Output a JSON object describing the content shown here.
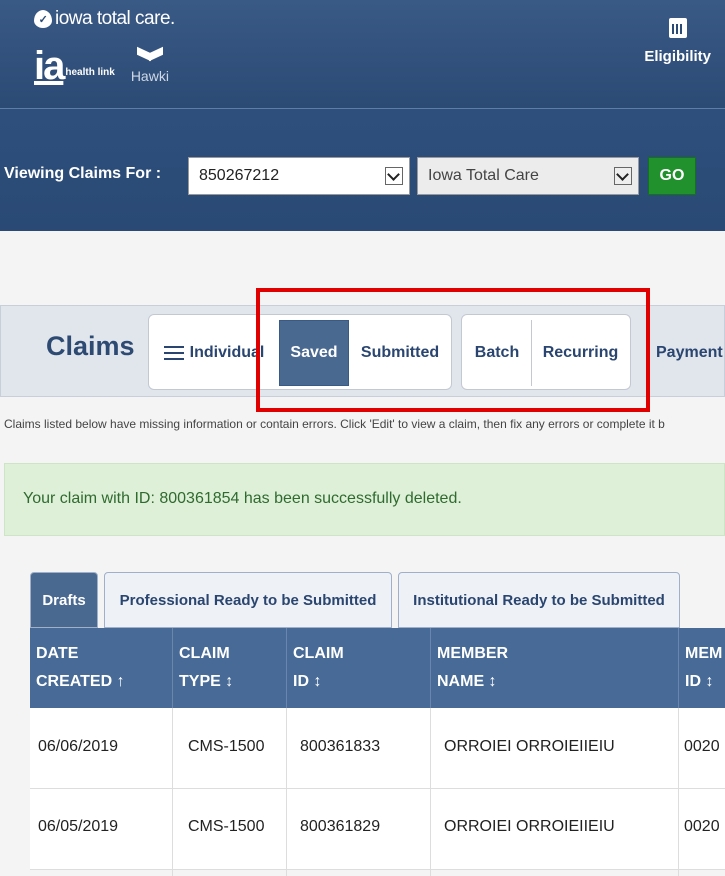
{
  "header": {
    "brand": "iowa total care.",
    "ia_logo": "ia",
    "health_link": "health link",
    "hawki": "Hawki",
    "eligibility": "Eligibility"
  },
  "filter": {
    "label": "Viewing Claims For :",
    "provider_id": "850267212",
    "plan": "Iowa Total Care",
    "go": "GO"
  },
  "claims_nav": {
    "title": "Claims",
    "individual": "Individual",
    "saved": "Saved",
    "submitted": "Submitted",
    "batch": "Batch",
    "recurring": "Recurring",
    "payment": "Payment"
  },
  "info_text": "Claims listed below have missing information or contain errors. Click 'Edit' to view a claim, then fix any errors or complete it b",
  "alert_text": "Your claim with ID: 800361854 has been successfully deleted.",
  "draft_tabs": {
    "drafts": "Drafts",
    "professional": "Professional Ready to be Submitted",
    "institutional": "Institutional Ready to be Submitted"
  },
  "table": {
    "headers": [
      [
        "DATE",
        "CREATED ↑"
      ],
      [
        "CLAIM",
        "TYPE ↕"
      ],
      [
        "CLAIM",
        "ID ↕"
      ],
      [
        "MEMBER",
        "NAME ↕"
      ],
      [
        "MEM",
        "ID ↕"
      ]
    ],
    "rows": [
      [
        "06/06/2019",
        "CMS-1500",
        "800361833",
        "ORROIEI ORROIEIIEIU",
        "0020"
      ],
      [
        "06/05/2019",
        "CMS-1500",
        "800361829",
        "ORROIEI ORROIEIIEIU",
        "0020"
      ]
    ]
  },
  "colors": {
    "header_blue": "#2b4a74",
    "active_tab": "#4a6990",
    "go_green": "#21912d",
    "highlight": "#e10000",
    "alert_bg": "#dff0d8"
  }
}
